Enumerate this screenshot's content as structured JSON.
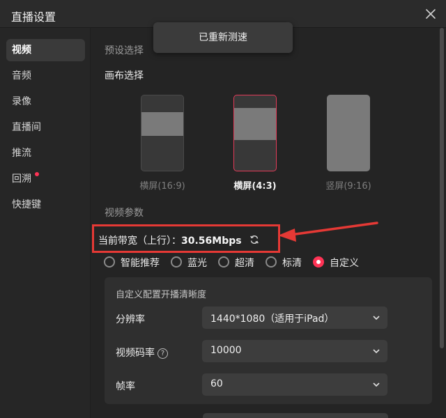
{
  "window": {
    "title": "直播设置"
  },
  "sidebar": {
    "items": [
      {
        "label": "视频",
        "active": true
      },
      {
        "label": "音频"
      },
      {
        "label": "录像"
      },
      {
        "label": "直播间"
      },
      {
        "label": "推流"
      },
      {
        "label": "回溯",
        "badge": true
      },
      {
        "label": "快捷键"
      }
    ]
  },
  "preset": {
    "section_title": "预设选择",
    "canvas_label": "画布选择"
  },
  "canvas_options": [
    {
      "label": "横屏(16:9)",
      "selected": false
    },
    {
      "label": "横屏(4:3)",
      "selected": true
    },
    {
      "label": "竖屏(9:16)",
      "selected": false
    }
  ],
  "video_params": {
    "section_title": "视频参数",
    "bandwidth_label": "当前带宽（上行）：",
    "bandwidth_value": "30.56Mbps",
    "quality_options": [
      {
        "label": "智能推荐",
        "checked": false
      },
      {
        "label": "蓝光",
        "checked": false
      },
      {
        "label": "超清",
        "checked": false
      },
      {
        "label": "标清",
        "checked": false
      },
      {
        "label": "自定义",
        "checked": true
      }
    ]
  },
  "custom": {
    "title": "自定义配置开播清晰度",
    "resolution": {
      "label": "分辨率",
      "value": "1440*1080（适用于iPad）"
    },
    "bitrate": {
      "label": "视频码率",
      "value": "10000"
    },
    "framerate": {
      "label": "帧率",
      "value": "60"
    }
  },
  "toast": {
    "text": "已重新测速"
  },
  "colors": {
    "accent": "#ff3355",
    "highlight_box": "#e53935"
  }
}
